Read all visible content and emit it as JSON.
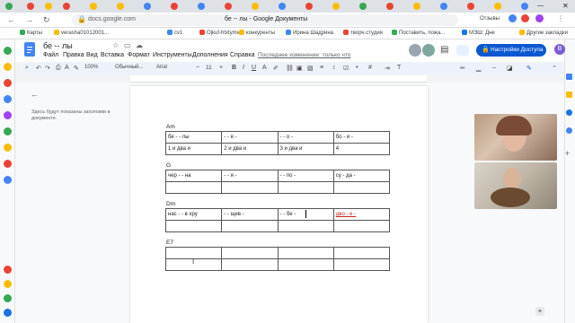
{
  "browser": {
    "url": "docs.google.com",
    "tab_count_label": "Отзывы",
    "bookmarks": [
      {
        "label": "Карты",
        "color": "#34a853"
      },
      {
        "label": "verasha01012001...",
        "color": "#fbbc04"
      },
      {
        "label": "cv1",
        "color": "#4285f4"
      },
      {
        "label": "Ojkuf-htxtymvf",
        "color": "#ea4335"
      },
      {
        "label": "конкуренты",
        "color": "#fbbc04"
      },
      {
        "label": "Ирина Шадрина",
        "color": "#4285f4"
      },
      {
        "label": "творч.студия",
        "color": "#ea4335"
      },
      {
        "label": "Поставить, пожа...",
        "color": "#34a853"
      },
      {
        "label": "МЭШ: Дне",
        "color": "#1a73e8"
      },
      {
        "label": "Другие закладки",
        "color": "#fbbc04"
      }
    ]
  },
  "doc": {
    "title": "бе -- лы",
    "window_title": "бе -- лы - Google Документы",
    "menu": [
      "Файл",
      "Правка",
      "Вид",
      "Вставка",
      "Формат",
      "Инструменты",
      "Дополнения",
      "Справка"
    ],
    "last_edit": "Последнее изменение: только что",
    "share_label": "Настройки Доступа",
    "avatar_letter": "B",
    "zoom": "100%",
    "style": "Обычный...",
    "font": "Arial",
    "font_size": "11",
    "outline_hint": "Здесь будут показаны заголовки в документе."
  },
  "chords": [
    {
      "label": "Am",
      "rows": [
        [
          "бе  -  -  лы",
          "-  -  е  -",
          "-  -  о  -",
          "бо  -  и  -"
        ],
        [
          "1  и  два  и",
          "2  и  два  и",
          "3  и  два  и",
          "4"
        ]
      ]
    },
    {
      "label": "G",
      "rows": [
        [
          "чер  -  -  на",
          "-  -  я  -",
          "-  -  по  -",
          "су  -  да  -"
        ],
        [
          "",
          "",
          "",
          ""
        ]
      ]
    },
    {
      "label": "Dm",
      "rows": [
        [
          "нас  -  -  в хру",
          "-  -  щев  -",
          "-  -  бе  -",
          "двo  -  е  -"
        ],
        [
          "",
          "",
          "",
          ""
        ]
      ]
    },
    {
      "label": "E7",
      "rows": [
        [
          "",
          "",
          "",
          ""
        ],
        [
          "",
          "",
          "",
          ""
        ]
      ]
    }
  ],
  "colors": {
    "accent": "#0b57d0",
    "docs_blue": "#4285f4",
    "share_bg": "#0b57d0"
  }
}
